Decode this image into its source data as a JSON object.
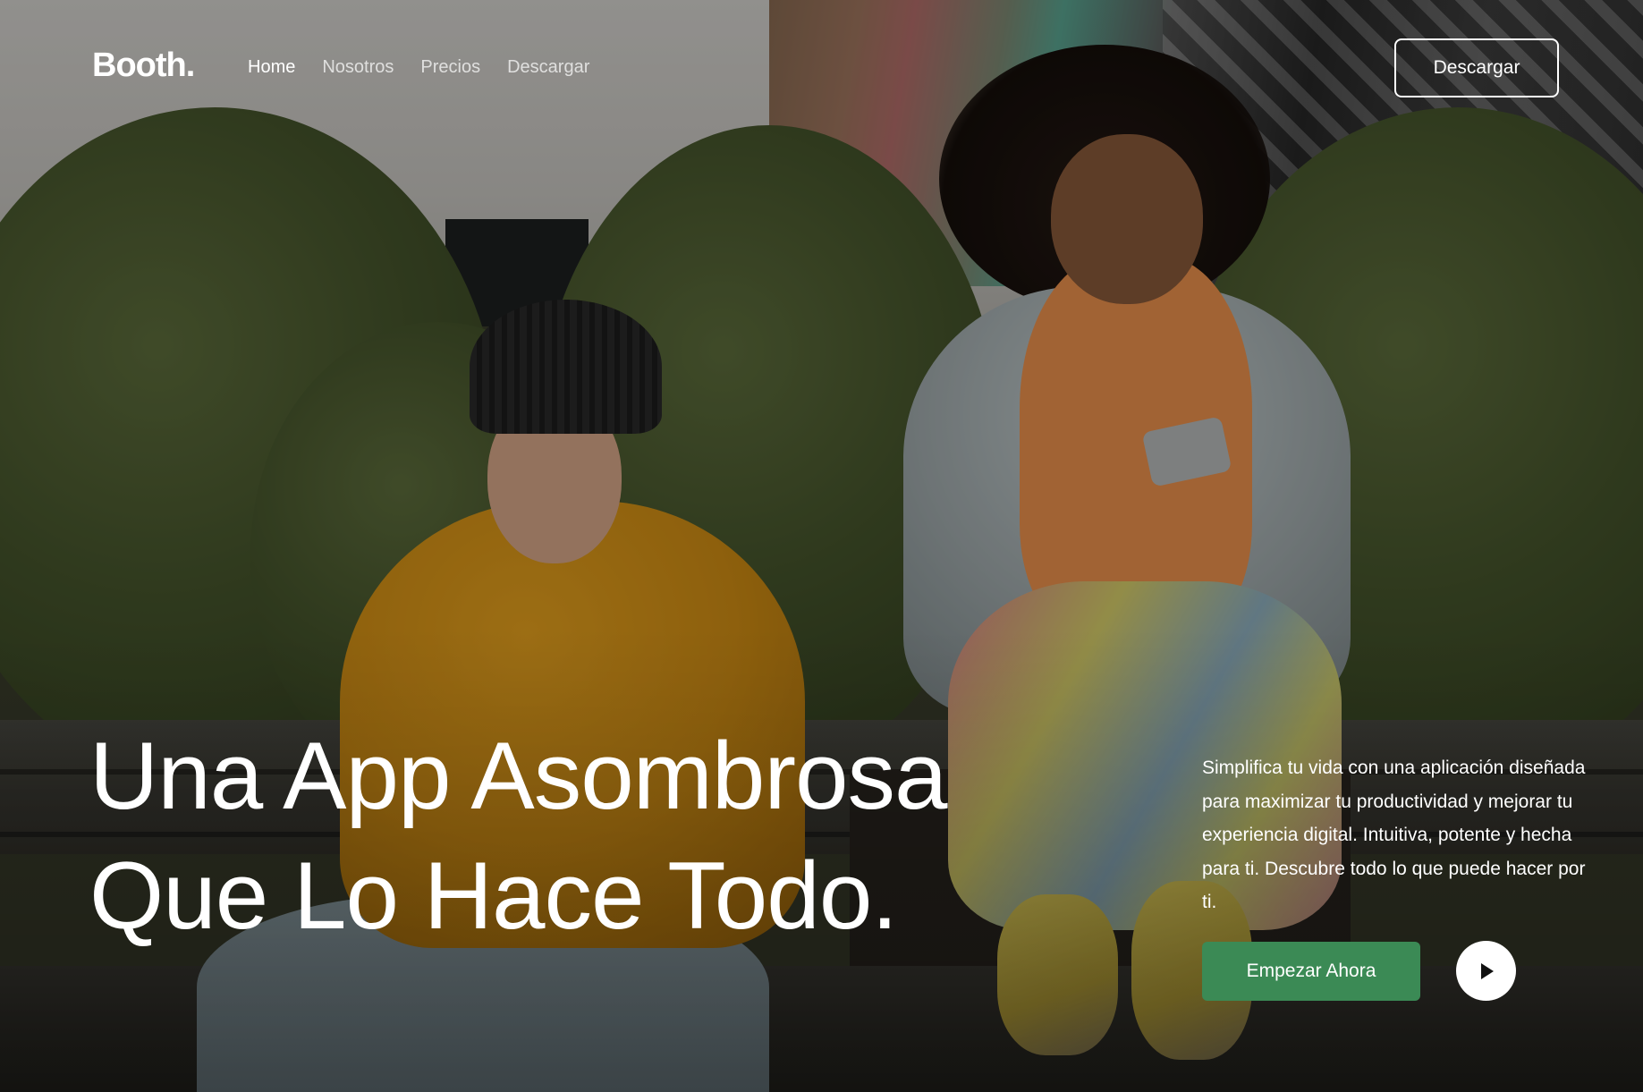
{
  "brand": {
    "logo_text": "Booth."
  },
  "nav": {
    "items": [
      {
        "label": "Home",
        "active": true
      },
      {
        "label": "Nosotros",
        "active": false
      },
      {
        "label": "Precios",
        "active": false
      },
      {
        "label": "Descargar",
        "active": false
      }
    ],
    "cta_label": "Descargar"
  },
  "hero": {
    "headline_line1": "Una App Asombrosa",
    "headline_line2": "Que Lo Hace Todo.",
    "description": "Simplifica tu vida con una aplicación diseñada para maximizar tu productividad y mejorar tu experiencia digital. Intuitiva, potente y hecha para ti. Descubre todo lo que puede hacer por ti.",
    "primary_button_label": "Empezar Ahora",
    "play_icon": "play-icon"
  },
  "colors": {
    "primary_button": "#3b8a55",
    "text": "#ffffff",
    "play_button_bg": "#ffffff"
  }
}
